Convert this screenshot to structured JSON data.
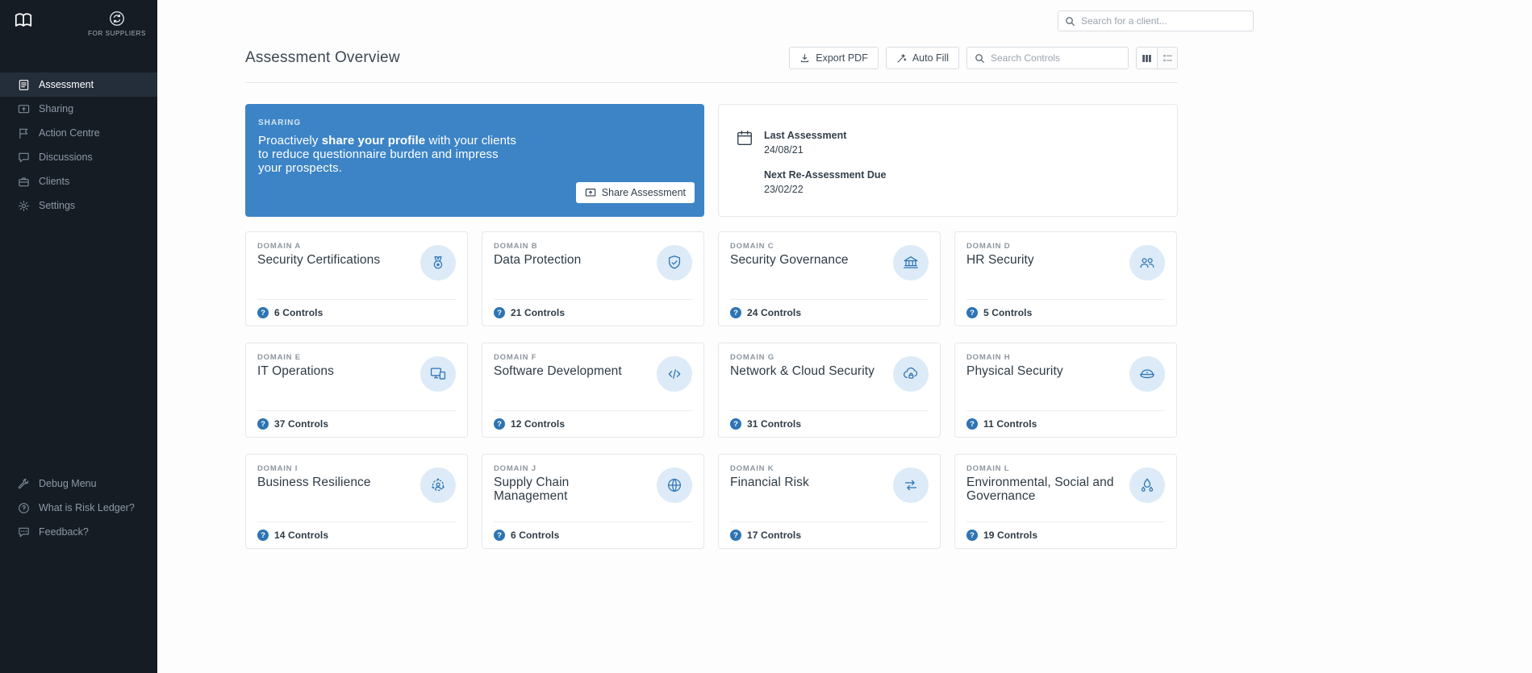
{
  "sidebar": {
    "brand": {
      "for_suppliers": "FOR SUPPLIERS"
    },
    "items": [
      {
        "label": "Assessment",
        "icon": "assessment-icon",
        "active": true
      },
      {
        "label": "Sharing",
        "icon": "sharing-icon",
        "active": false
      },
      {
        "label": "Action Centre",
        "icon": "action-centre-icon",
        "active": false
      },
      {
        "label": "Discussions",
        "icon": "discussions-icon",
        "active": false
      },
      {
        "label": "Clients",
        "icon": "clients-icon",
        "active": false
      },
      {
        "label": "Settings",
        "icon": "settings-icon",
        "active": false
      }
    ],
    "footer_items": [
      {
        "label": "Debug Menu",
        "icon": "wrench-icon"
      },
      {
        "label": "What is Risk Ledger?",
        "icon": "question-circle-icon"
      },
      {
        "label": "Feedback?",
        "icon": "feedback-icon"
      }
    ]
  },
  "topbar": {
    "client_search_placeholder": "Search for a client..."
  },
  "header": {
    "title": "Assessment Overview",
    "export_pdf_label": "Export PDF",
    "auto_fill_label": "Auto Fill",
    "controls_search_placeholder": "Search Controls"
  },
  "sharing_banner": {
    "eyebrow": "SHARING",
    "text_prefix": "Proactively ",
    "text_bold": "share your profile",
    "text_suffix": " with your clients to reduce questionnaire burden and impress your prospects.",
    "button_label": "Share Assessment"
  },
  "assessment_dates": {
    "last_assessment_label": "Last Assessment",
    "last_assessment_value": "24/08/21",
    "next_label": "Next Re-Assessment Due",
    "next_value": "23/02/22"
  },
  "icons": {
    "help_glyph": "?"
  },
  "colors": {
    "accent_blue": "#3c84c6",
    "icon_blue": "#2e74b4",
    "icon_circle_bg": "#dcebf7",
    "sidebar_bg": "#151c24"
  },
  "domains": [
    {
      "domain": "DOMAIN A",
      "title": "Security Certifications",
      "controls": "6 Controls",
      "icon": "medal-icon"
    },
    {
      "domain": "DOMAIN B",
      "title": "Data Protection",
      "controls": "21 Controls",
      "icon": "shield-check-icon"
    },
    {
      "domain": "DOMAIN C",
      "title": "Security Governance",
      "controls": "24 Controls",
      "icon": "bank-icon"
    },
    {
      "domain": "DOMAIN D",
      "title": "HR Security",
      "controls": "5 Controls",
      "icon": "people-icon"
    },
    {
      "domain": "DOMAIN E",
      "title": "IT Operations",
      "controls": "37 Controls",
      "icon": "devices-icon"
    },
    {
      "domain": "DOMAIN F",
      "title": "Software Development",
      "controls": "12 Controls",
      "icon": "code-icon"
    },
    {
      "domain": "DOMAIN G",
      "title": "Network & Cloud Security",
      "controls": "31 Controls",
      "icon": "cloud-icon"
    },
    {
      "domain": "DOMAIN H",
      "title": "Physical Security",
      "controls": "11 Controls",
      "icon": "guard-cap-icon"
    },
    {
      "domain": "DOMAIN I",
      "title": "Business Resilience",
      "controls": "14 Controls",
      "icon": "orbit-person-icon"
    },
    {
      "domain": "DOMAIN J",
      "title": "Supply Chain Management",
      "controls": "6 Controls",
      "icon": "globe-icon"
    },
    {
      "domain": "DOMAIN K",
      "title": "Financial Risk",
      "controls": "17 Controls",
      "icon": "money-transfer-icon"
    },
    {
      "domain": "DOMAIN L",
      "title": "Environmental, Social and Governance",
      "controls": "19 Controls",
      "icon": "droplets-icon"
    }
  ]
}
